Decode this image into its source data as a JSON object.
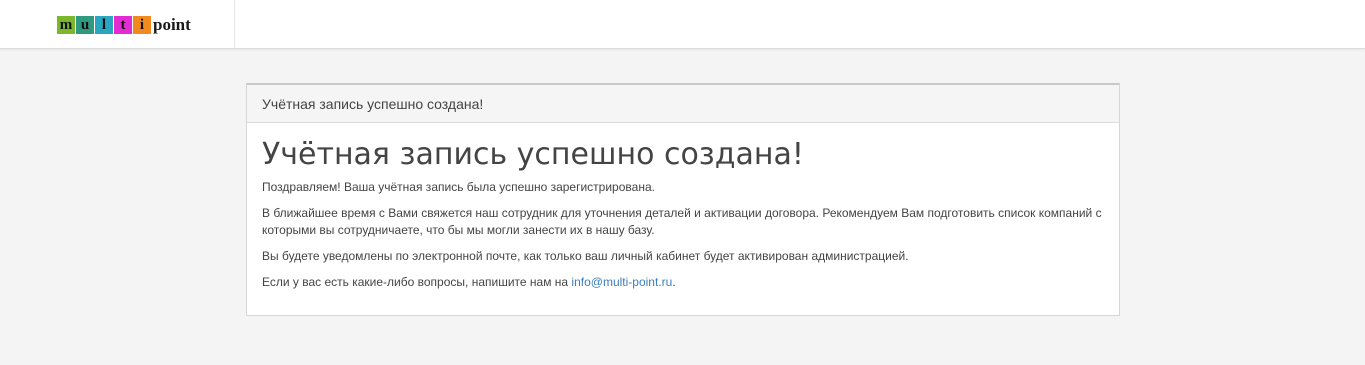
{
  "header": {
    "logo": {
      "letters": [
        {
          "char": "m",
          "color": "#7ab72a"
        },
        {
          "char": "u",
          "color": "#2f9a7f"
        },
        {
          "char": "l",
          "color": "#2aa6c0"
        },
        {
          "char": "t",
          "color": "#e22bd1"
        },
        {
          "char": "i",
          "color": "#f1891e"
        }
      ],
      "rest": "point"
    }
  },
  "panel": {
    "heading": "Учётная запись успешно создана!",
    "title": "Учётная запись успешно создана!",
    "paragraphs": {
      "congrats": "Поздравляем! Ваша учётная запись была успешно зарегистрирована.",
      "contact": "В ближайшее время с Вами свяжется наш сотрудник для уточнения деталей и активации договора. Рекомендуем Вам подготовить список компаний с которыми вы сотрудничаете, что бы мы могли занести их в нашу базу.",
      "notify": "Вы будете уведомлены по электронной почте, как только ваш личный кабинет будет активирован администрацией.",
      "questions_prefix": "Если у вас есть какие-либо вопросы, напишите нам на ",
      "email": "info@multi-point.ru",
      "questions_suffix": "."
    }
  },
  "colors": {
    "background": "#f4f4f4",
    "link": "#3a7fbf"
  }
}
